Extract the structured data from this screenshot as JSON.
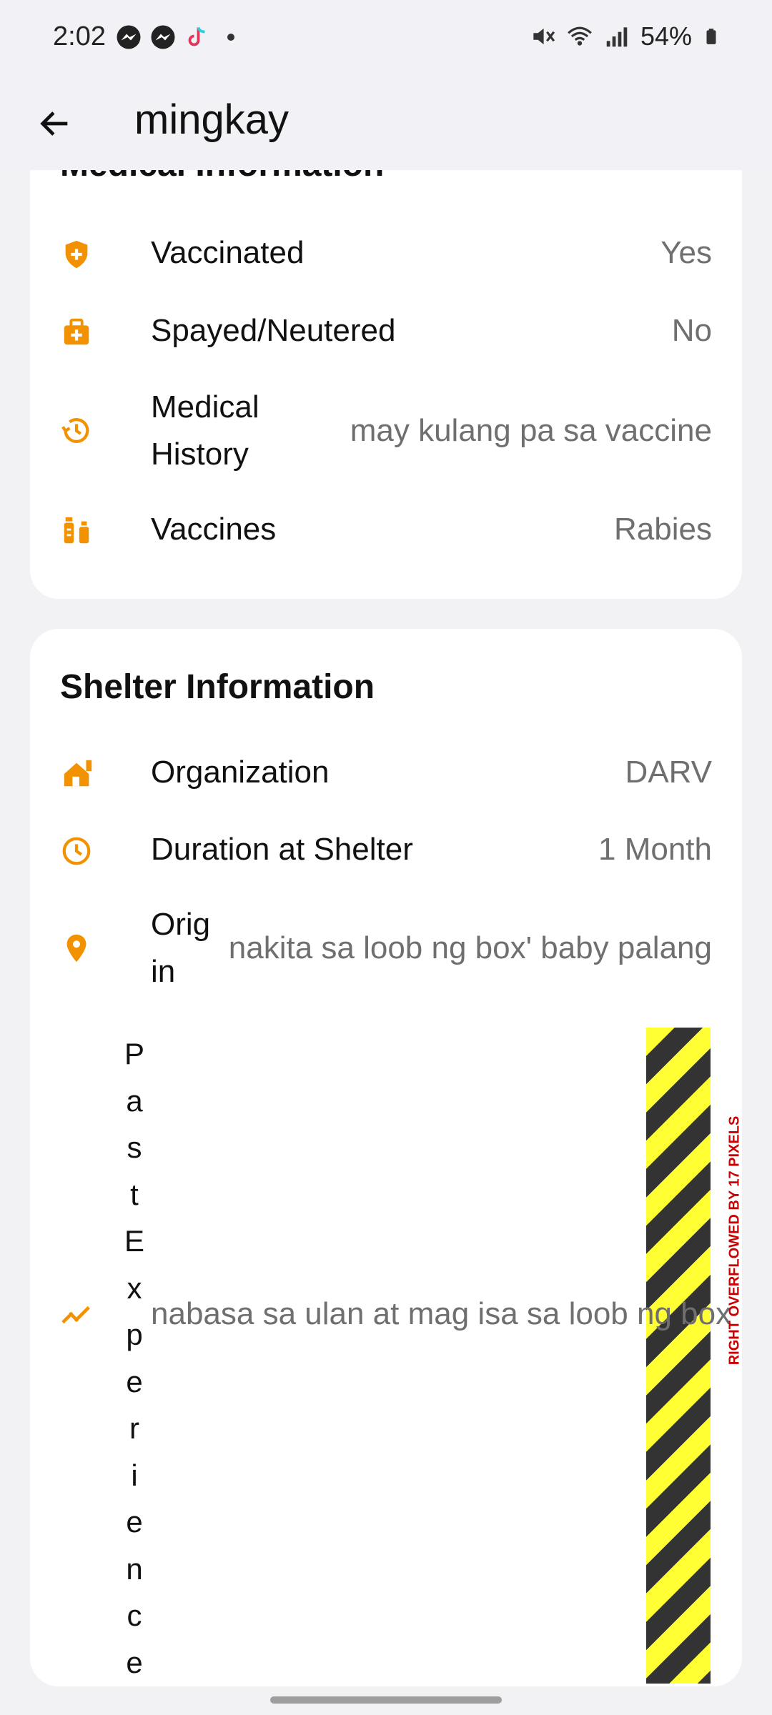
{
  "status_bar": {
    "time": "2:02",
    "battery": "54%",
    "left_icons": [
      "messenger-icon",
      "messenger-icon",
      "tiktok-icon",
      "notification-dot"
    ],
    "right_icons": [
      "mute-icon",
      "wifi-icon",
      "signal-icon",
      "battery-icon"
    ]
  },
  "app_bar": {
    "title": "mingkay"
  },
  "medical": {
    "title": "Medical Information",
    "rows": [
      {
        "label": "Vaccinated",
        "value": "Yes",
        "icon": "shield-plus-icon"
      },
      {
        "label": "Spayed/Neutered",
        "value": "No",
        "icon": "medical-bag-icon"
      },
      {
        "label": "Medical History",
        "label_line1": "Medical",
        "label_line2": "History",
        "value": "may kulang pa sa vaccine",
        "icon": "history-icon"
      },
      {
        "label": "Vaccines",
        "value": "Rabies",
        "icon": "vaccine-icon"
      }
    ]
  },
  "shelter": {
    "title": "Shelter Information",
    "rows": [
      {
        "label": "Organization",
        "value": "DARV",
        "icon": "house-icon"
      },
      {
        "label": "Duration at Shelter",
        "value": "1 Month",
        "icon": "clock-icon"
      },
      {
        "label": "Origin",
        "label_line1": "Orig",
        "label_line2": "in",
        "value": "nakita sa loob ng box' baby palang",
        "icon": "location-pin-icon"
      },
      {
        "label": "Past Experience",
        "value": "nabasa sa ulan at mag isa sa loob ng box",
        "icon": "trending-icon"
      }
    ],
    "overflow_message": "RIGHT OVERFLOWED BY 17 PIXELS"
  },
  "colors": {
    "accent": "#f29200",
    "value_text": "#6f6f6f",
    "background": "#f2f2f5"
  }
}
